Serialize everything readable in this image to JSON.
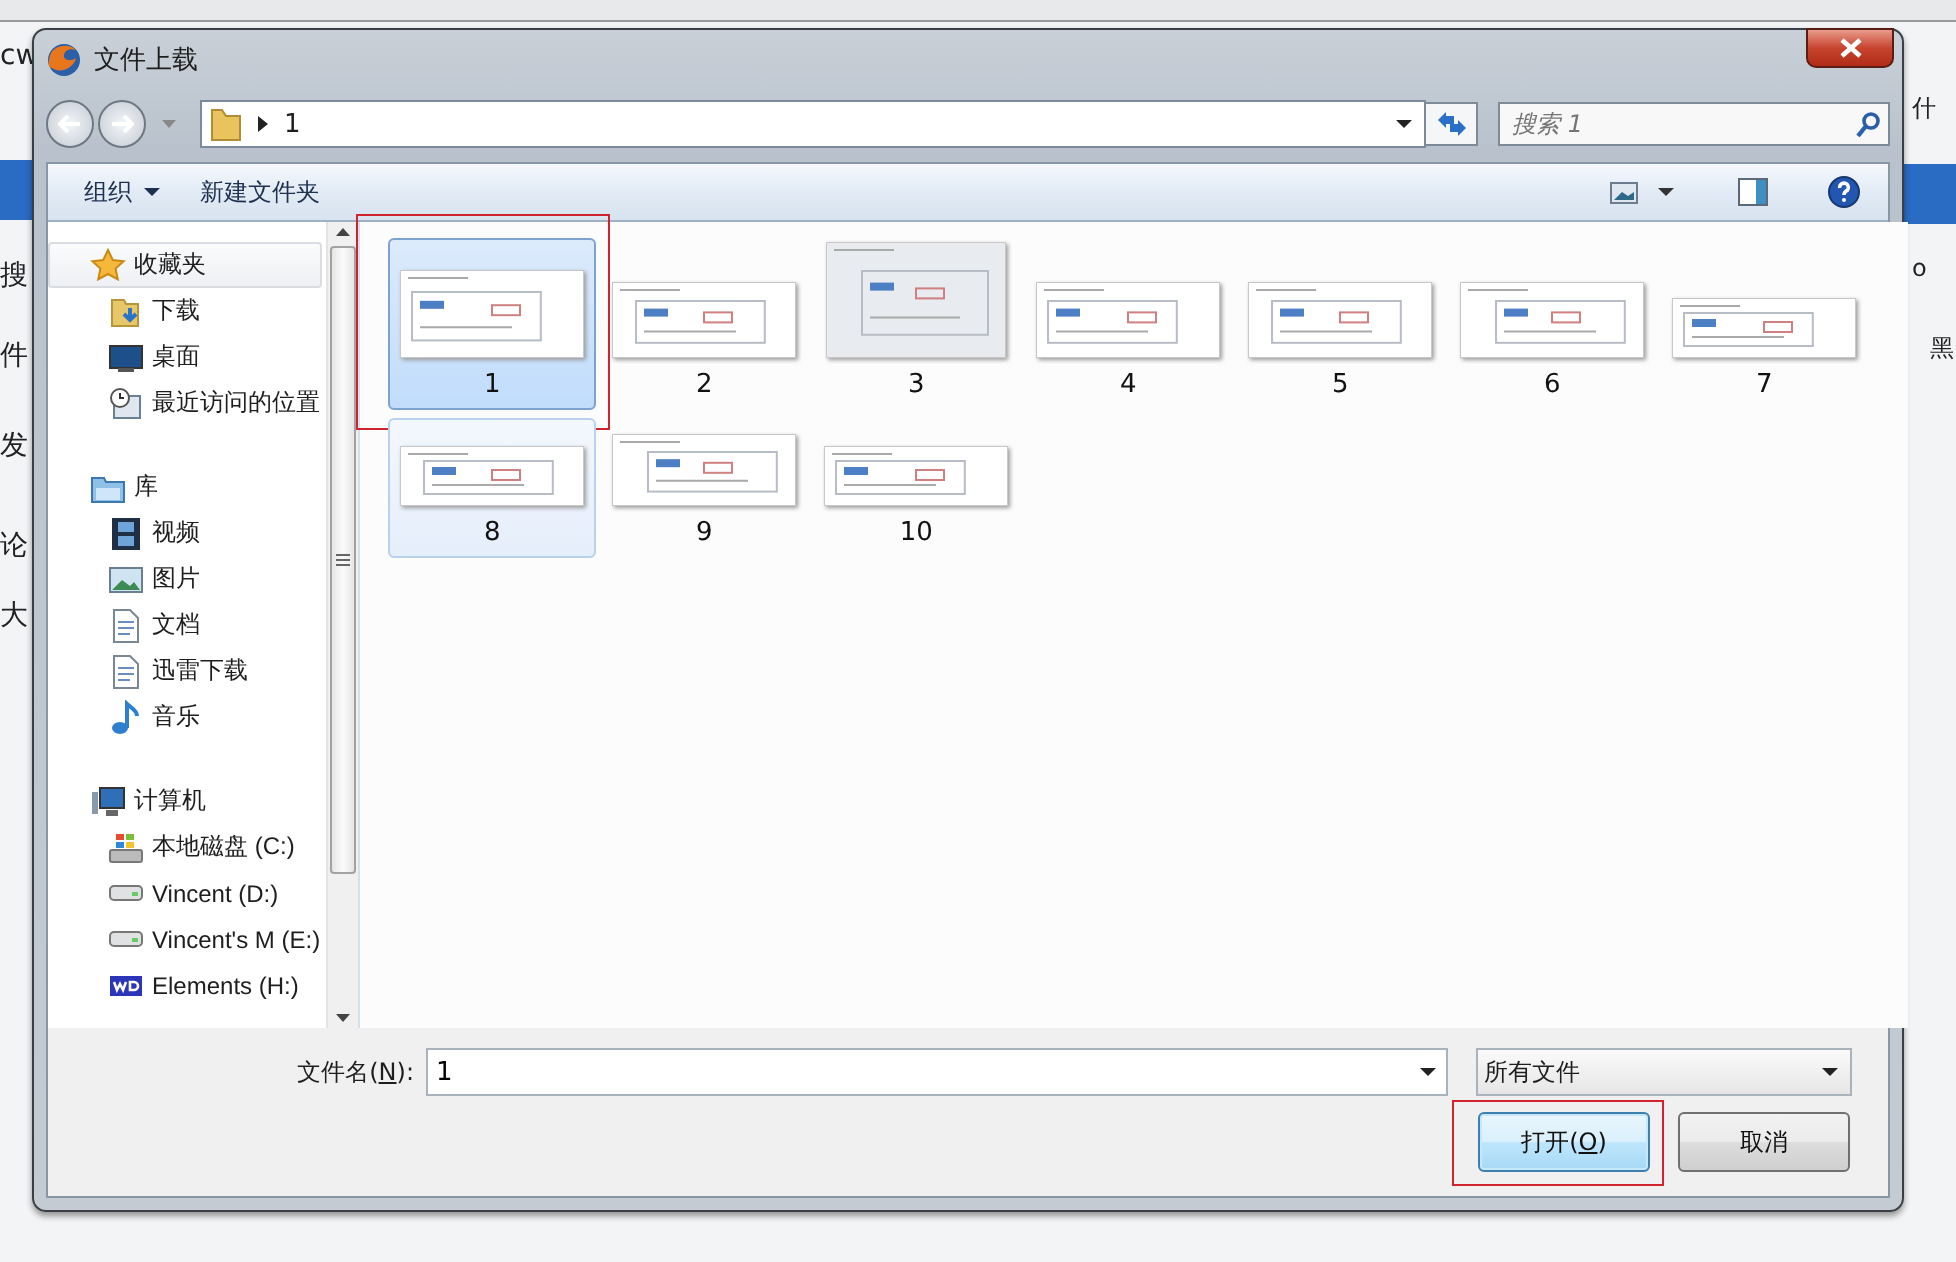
{
  "background": {
    "left_fragments": [
      "cw",
      "搜",
      "件",
      "发",
      "论",
      "大"
    ],
    "right_fragments": [
      "什",
      "o",
      "黑"
    ]
  },
  "dialog": {
    "title": "文件上载",
    "path": [
      "1"
    ],
    "search": {
      "placeholder": "搜索 1"
    },
    "toolbar": {
      "organize": "组织",
      "new_folder": "新建文件夹"
    },
    "nav": [
      {
        "label": "收藏夹",
        "kind": "favorites",
        "selected": true,
        "children": [
          {
            "label": "下载",
            "kind": "downloads",
            "selected": false
          },
          {
            "label": "桌面",
            "kind": "desktop",
            "selected": false
          },
          {
            "label": "最近访问的位置",
            "kind": "recent",
            "selected": false
          }
        ]
      },
      {
        "label": "库",
        "kind": "library",
        "selected": false,
        "children": [
          {
            "label": "视频",
            "kind": "video",
            "selected": false
          },
          {
            "label": "图片",
            "kind": "pictures",
            "selected": false
          },
          {
            "label": "文档",
            "kind": "documents",
            "selected": false
          },
          {
            "label": "迅雷下载",
            "kind": "documents",
            "selected": false
          },
          {
            "label": "音乐",
            "kind": "music",
            "selected": false
          }
        ]
      },
      {
        "label": "计算机",
        "kind": "computer",
        "selected": false,
        "children": [
          {
            "label": "本地磁盘 (C:)",
            "kind": "system-drive",
            "selected": false
          },
          {
            "label": "Vincent (D:)",
            "kind": "drive",
            "selected": false
          },
          {
            "label": "Vincent's M (E:)",
            "kind": "drive",
            "selected": false
          },
          {
            "label": "Elements (H:)",
            "kind": "wd-drive",
            "selected": false
          }
        ]
      }
    ],
    "files": [
      {
        "name": "1",
        "selected": true,
        "hot": false,
        "marked": true
      },
      {
        "name": "2",
        "selected": false,
        "hot": false,
        "marked": false
      },
      {
        "name": "3",
        "selected": false,
        "hot": false,
        "marked": false
      },
      {
        "name": "4",
        "selected": false,
        "hot": false,
        "marked": false
      },
      {
        "name": "5",
        "selected": false,
        "hot": false,
        "marked": false
      },
      {
        "name": "6",
        "selected": false,
        "hot": false,
        "marked": false
      },
      {
        "name": "7",
        "selected": false,
        "hot": false,
        "marked": false
      },
      {
        "name": "8",
        "selected": false,
        "hot": true,
        "marked": false
      },
      {
        "name": "9",
        "selected": false,
        "hot": false,
        "marked": false
      },
      {
        "name": "10",
        "selected": false,
        "hot": false,
        "marked": false
      }
    ],
    "file_name": {
      "label": "文件名(",
      "accesskey": "N",
      "label_end": "):",
      "value": "1"
    },
    "file_type": {
      "value": "所有文件"
    },
    "buttons": [
      {
        "label": "打开(",
        "accesskey": "O",
        "label_end": ")",
        "kind": "default",
        "marked": true
      },
      {
        "label": "取消",
        "kind": "normal",
        "marked": false
      }
    ]
  }
}
